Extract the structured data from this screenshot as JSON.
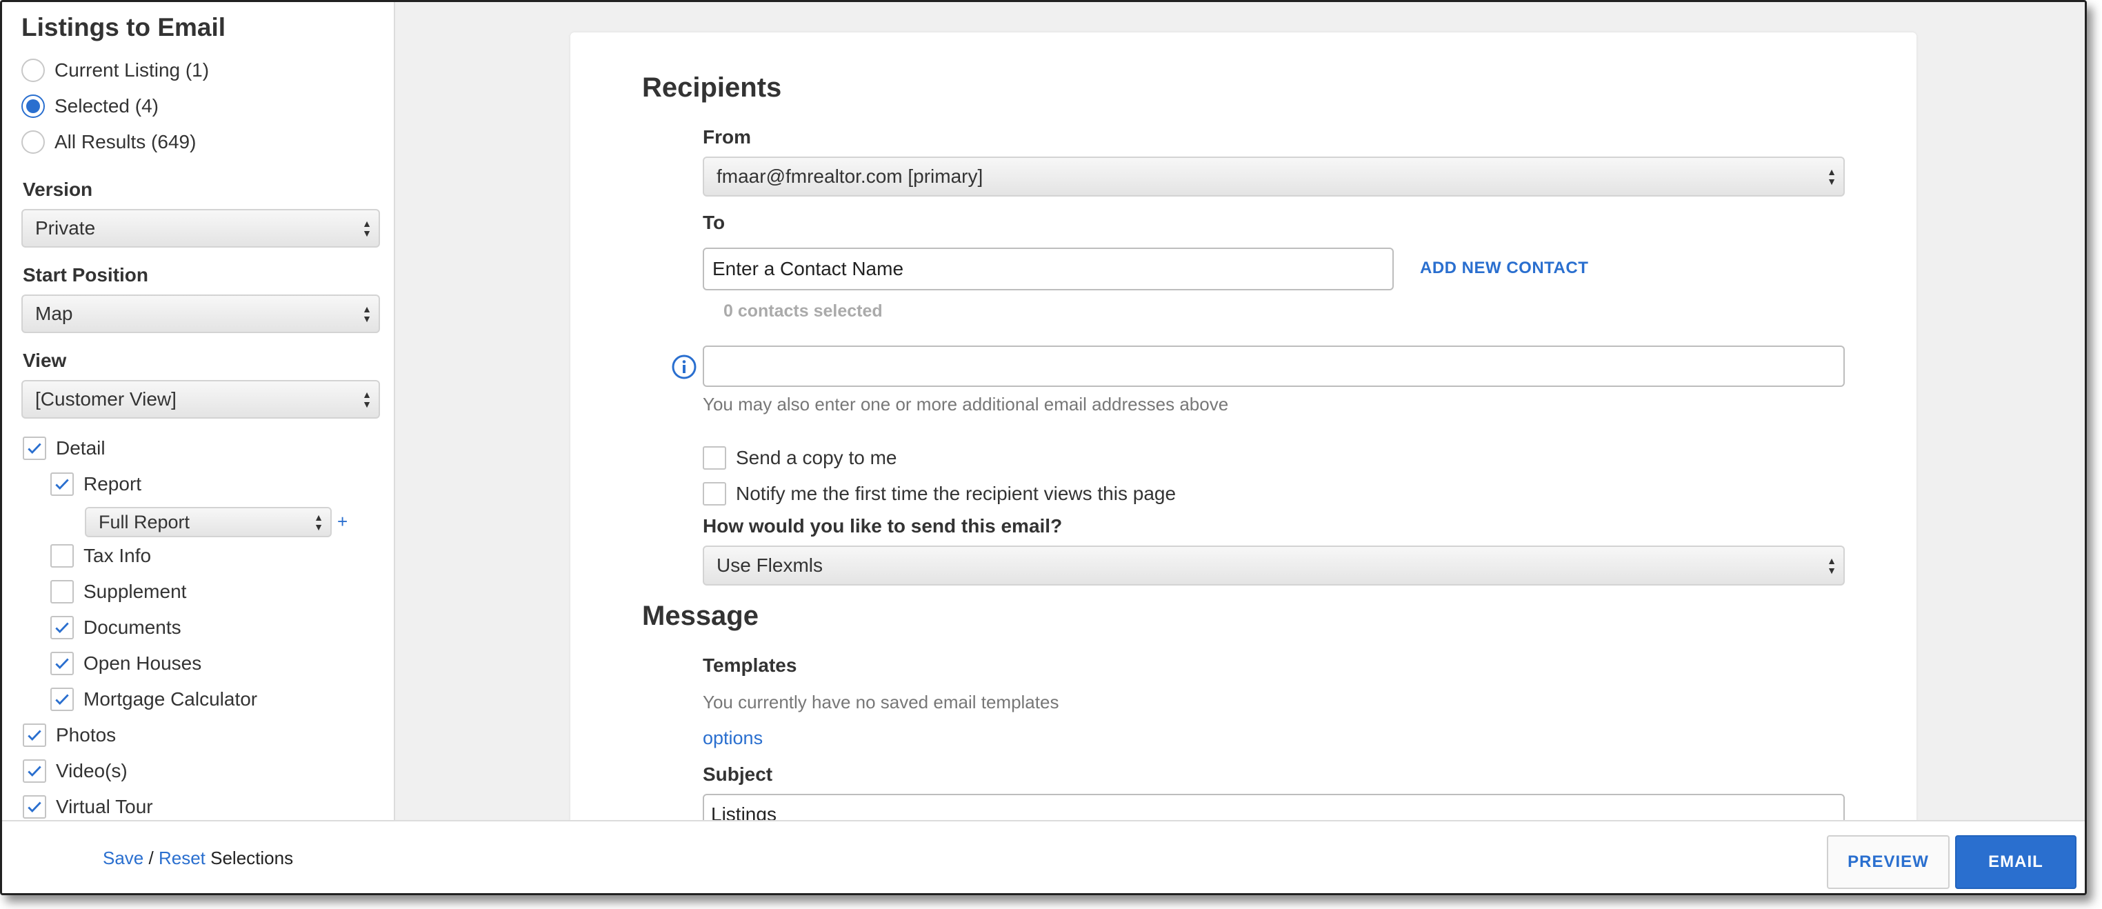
{
  "sidebar": {
    "title": "Listings to Email",
    "radios": [
      {
        "label": "Current Listing (1)",
        "checked": false
      },
      {
        "label": "Selected (4)",
        "checked": true
      },
      {
        "label": "All Results (649)",
        "checked": false
      }
    ],
    "version": {
      "label": "Version",
      "value": "Private"
    },
    "start_position": {
      "label": "Start Position",
      "value": "Map"
    },
    "view": {
      "label": "View",
      "value": "[Customer View]"
    },
    "checks": [
      {
        "label": "Detail",
        "checked": true
      },
      {
        "label": "Report",
        "checked": true
      },
      {
        "label": "Tax Info",
        "checked": false
      },
      {
        "label": "Supplement",
        "checked": false
      },
      {
        "label": "Documents",
        "checked": true
      },
      {
        "label": "Open Houses",
        "checked": true
      },
      {
        "label": "Mortgage Calculator",
        "checked": true
      },
      {
        "label": "Photos",
        "checked": true
      },
      {
        "label": "Video(s)",
        "checked": true
      },
      {
        "label": "Virtual Tour",
        "checked": true
      }
    ],
    "report_select": "Full Report",
    "plus": "+"
  },
  "recipients": {
    "heading": "Recipients",
    "from_label": "From",
    "from_value": "fmaar@fmrealtor.com [primary]",
    "to_label": "To",
    "to_placeholder": "Enter a Contact Name",
    "add_contact": "ADD NEW CONTACT",
    "contacts_selected": "0 contacts selected",
    "additional_hint": "You may also enter one or more additional email addresses above",
    "send_copy": "Send a copy to me",
    "notify": "Notify me the first time the recipient views this page",
    "send_method_label": "How would you like to send this email?",
    "send_method_value": "Use Flexmls"
  },
  "message": {
    "heading": "Message",
    "templates_label": "Templates",
    "templates_text": "You currently have no saved email templates",
    "options_link": "options",
    "subject_label": "Subject",
    "subject_value": "Listings"
  },
  "footer": {
    "save": "Save",
    "sep": "/",
    "reset": "Reset",
    "selections": "Selections",
    "preview": "PREVIEW",
    "email": "EMAIL"
  },
  "colors": {
    "accent": "#2a6fcf",
    "main_bg": "#f0f0f0"
  }
}
